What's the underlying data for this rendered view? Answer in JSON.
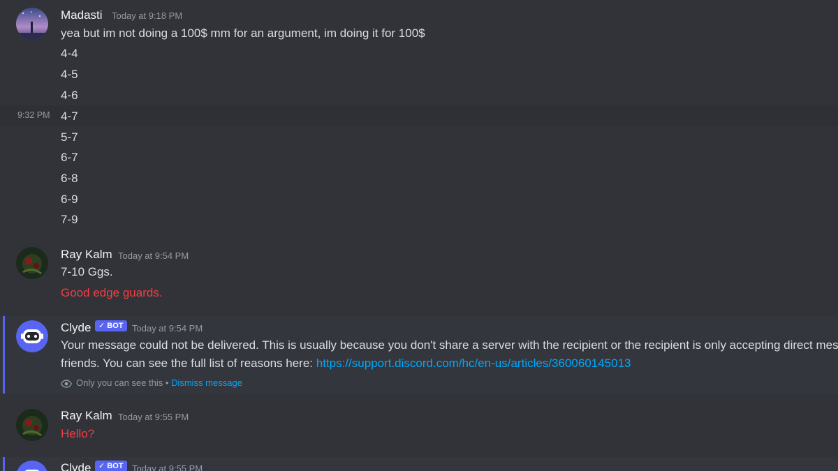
{
  "messages": {
    "madasti": {
      "username": "Madasti",
      "timestamp": "Today at 9:18 PM",
      "lines": [
        "yea but im not doing a 100$ mm for an argument, im doing it for 100$",
        "4-4",
        "4-5",
        "4-6",
        "4-7",
        "5-7",
        "6-7",
        "6-8",
        "6-9",
        "7-9"
      ],
      "hover_time": "9:32 PM"
    },
    "ray1": {
      "username": "Ray Kalm",
      "timestamp": "Today at 9:54 PM",
      "line1": "7-10 Ggs.",
      "line2": "Good edge guards."
    },
    "clyde1": {
      "username": "Clyde",
      "bot_tag": "✓ BOT",
      "timestamp": "Today at 9:54 PM",
      "text_line1": "Your message could not be delivered. This is usually because you don't share a server with the recipient or the recipient is only accepting direct mes",
      "text_line2_prefix": "friends. You can see the full list of reasons here: ",
      "link": "https://support.discord.com/hc/en-us/articles/360060145013",
      "only_you": "Only you can see this •",
      "dismiss": "Dismiss message"
    },
    "ray2": {
      "username": "Ray Kalm",
      "timestamp": "Today at 9:55 PM",
      "line1": "Hello?"
    },
    "clyde2": {
      "username": "Clyde",
      "bot_tag": "✓ BOT",
      "timestamp": "Today at 9:55 PM"
    }
  },
  "colors": {
    "background": "#313338",
    "text": "#dbdee1",
    "error_red": "#f23f43",
    "link": "#00a8fc",
    "bot_accent": "#5865f2"
  },
  "icons": [
    "eye-icon",
    "clyde-avatar",
    "user-avatar"
  ]
}
